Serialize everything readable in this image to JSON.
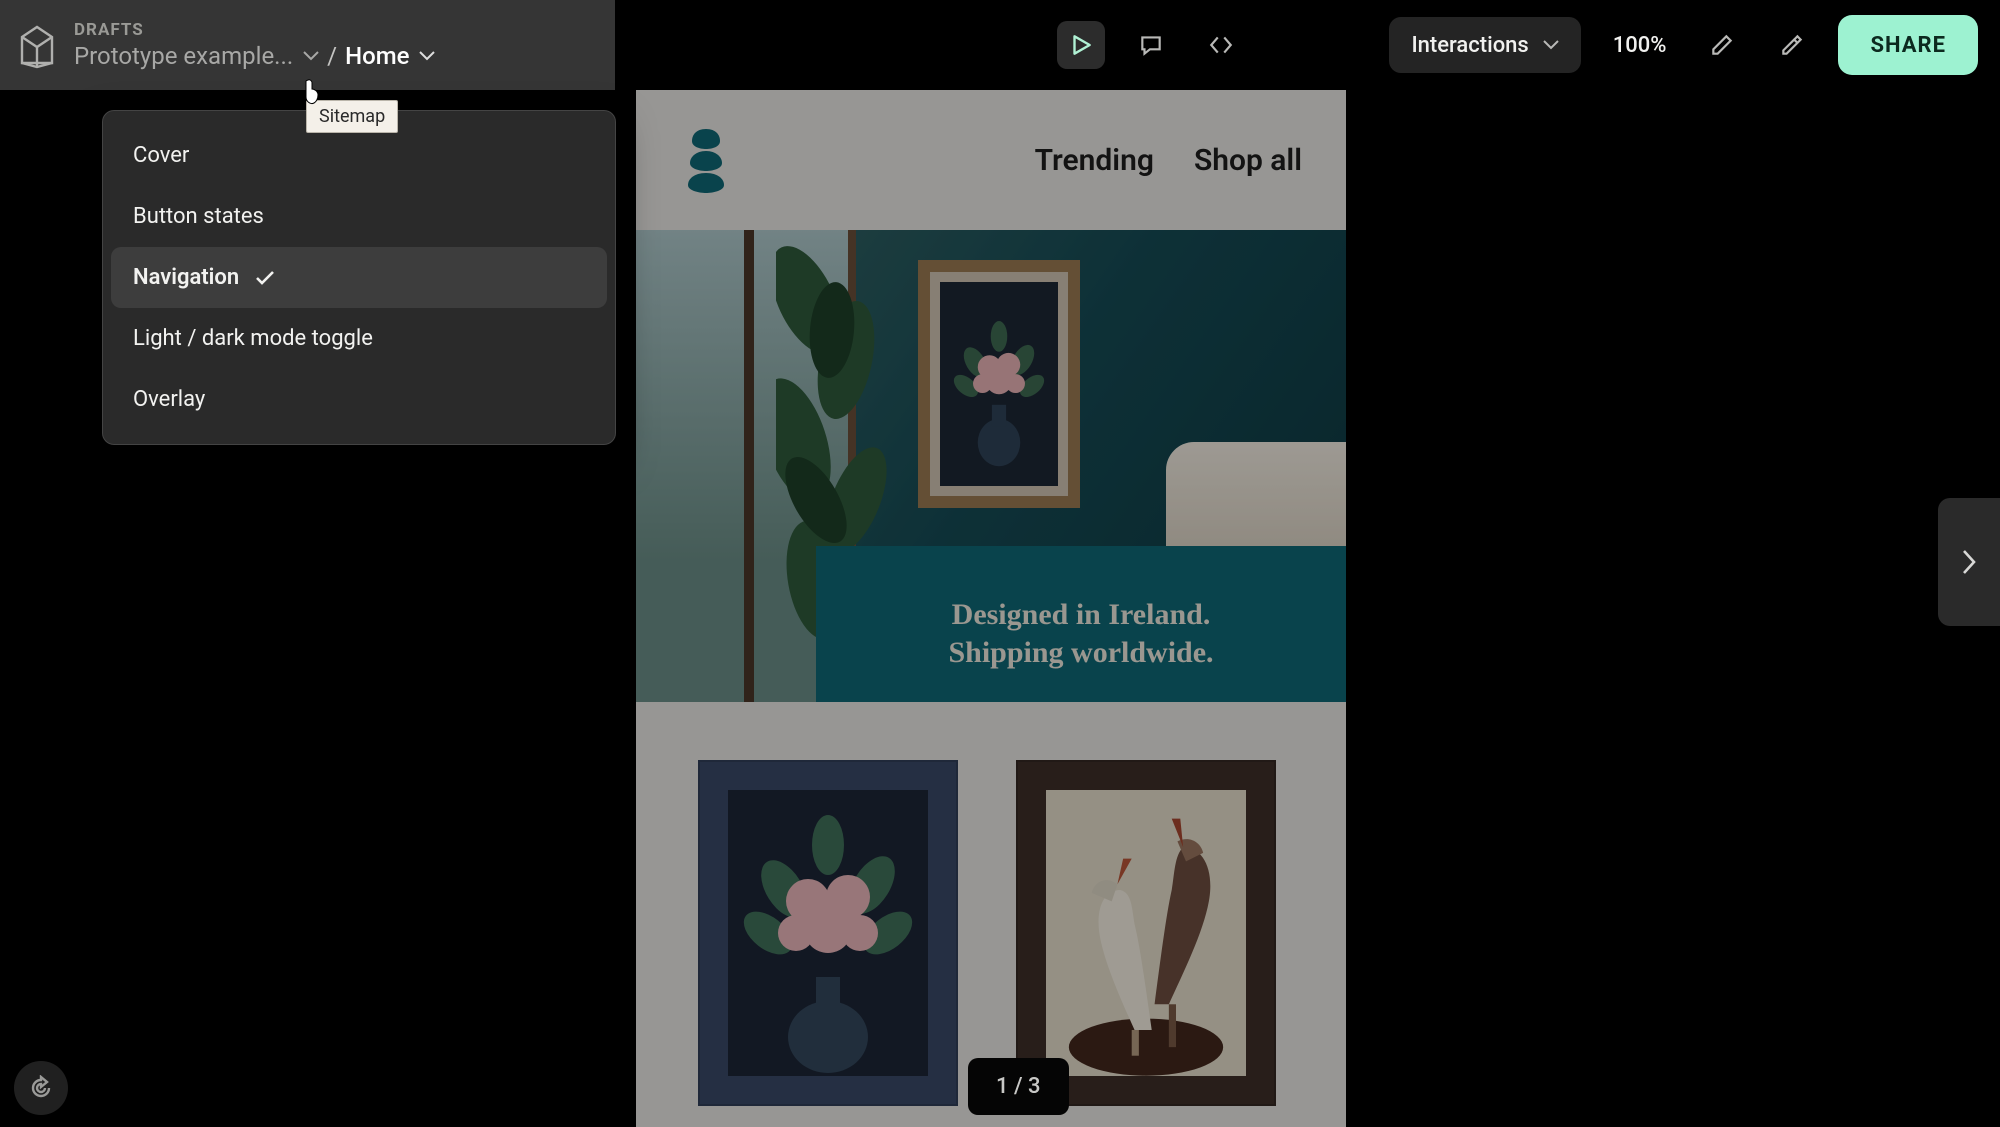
{
  "topbar": {
    "crumb_section": "DRAFTS",
    "project_name": "Prototype example...",
    "frame_name": "Home",
    "separator": "/",
    "interactions_label": "Interactions",
    "zoom": "100%",
    "share": "SHARE"
  },
  "sitemap": {
    "tooltip": "Sitemap",
    "items": [
      {
        "label": "Cover",
        "selected": false
      },
      {
        "label": "Button states",
        "selected": false
      },
      {
        "label": "Navigation",
        "selected": true
      },
      {
        "label": "Light / dark mode toggle",
        "selected": false
      },
      {
        "label": "Overlay",
        "selected": false
      }
    ]
  },
  "preview": {
    "nav": {
      "link_trending": "Trending",
      "link_shop_all": "Shop all"
    },
    "hero": {
      "line1": "Designed in Ireland.",
      "line2": "Shipping worldwide."
    }
  },
  "pager": {
    "current": 1,
    "total": 3,
    "display": "1 / 3"
  },
  "colors": {
    "accent_share": "#9DF2D1",
    "hero_banner": "#0E6876",
    "canvas_bg": "#E9E7E3"
  }
}
